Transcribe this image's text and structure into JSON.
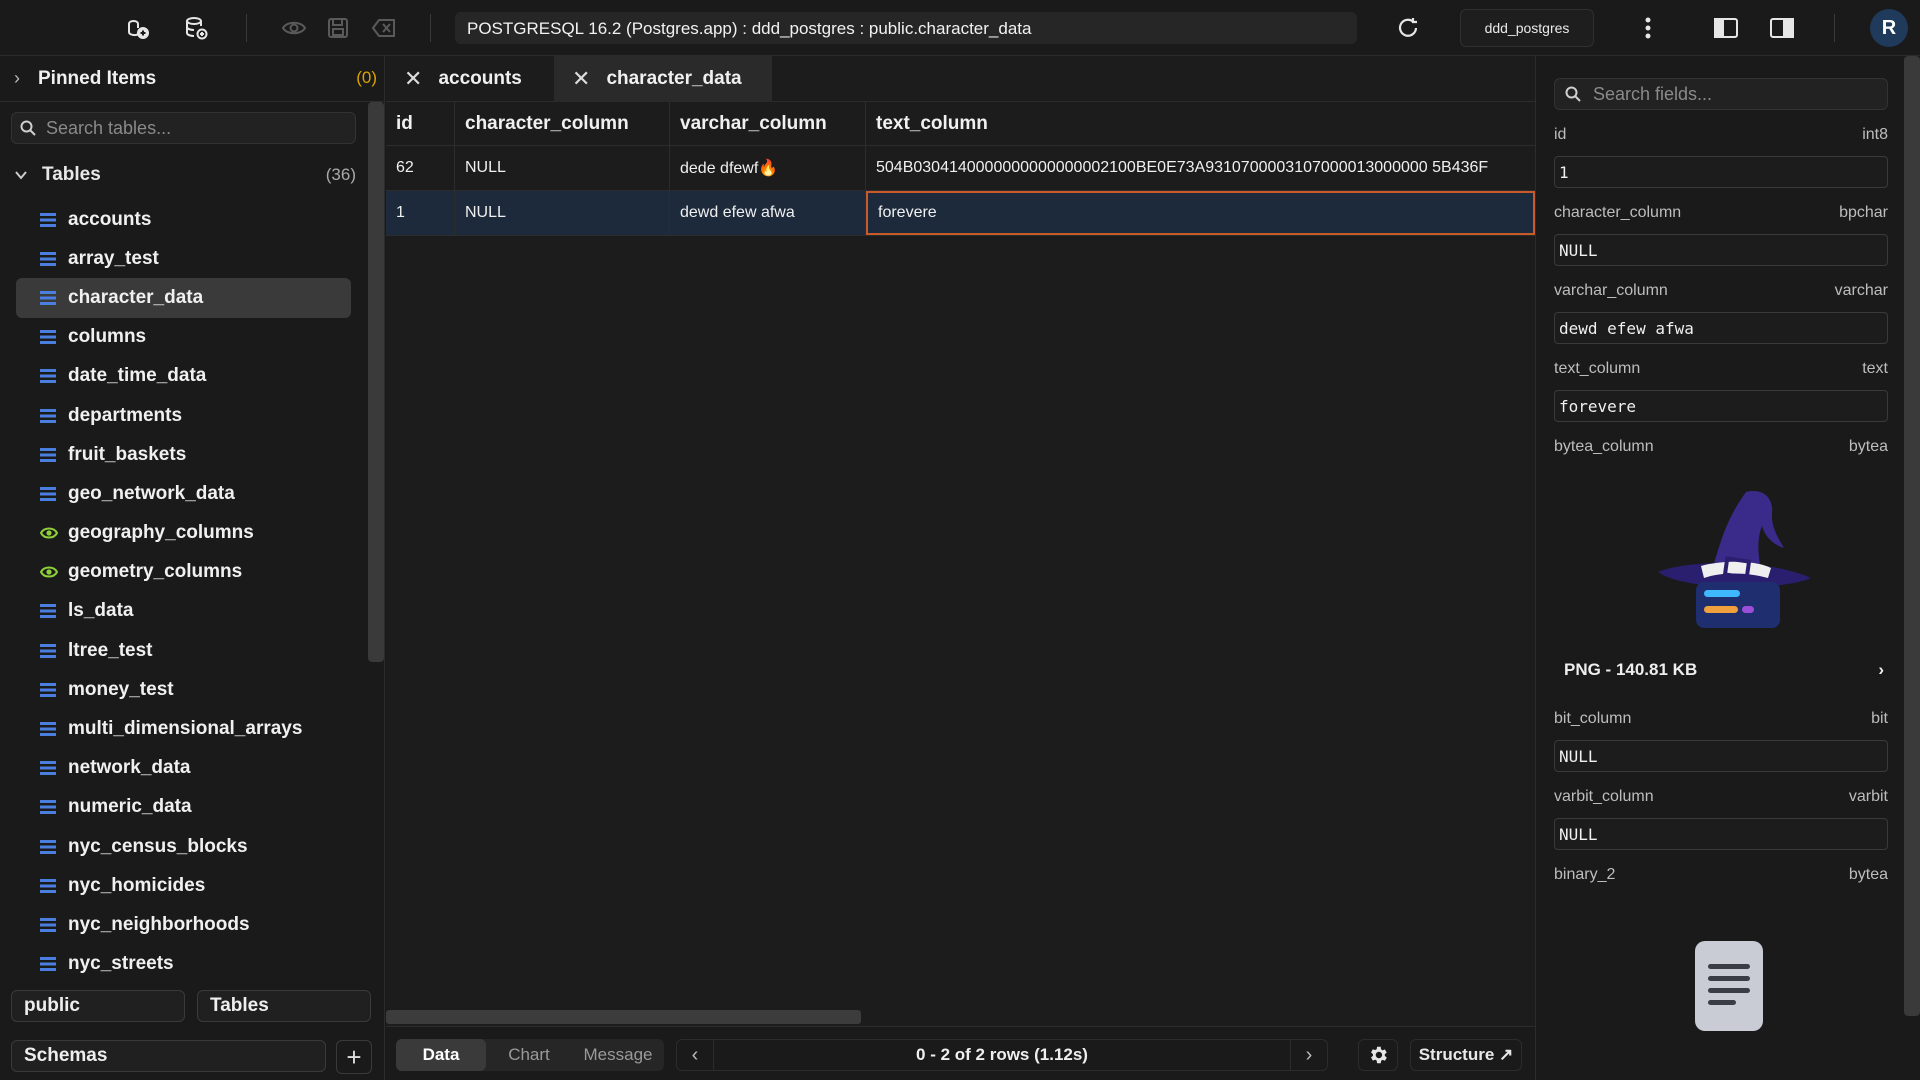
{
  "toolbar": {
    "connection": "POSTGRESQL 16.2 (Postgres.app) : ddd_postgres : public.character_data",
    "database_button": "ddd_postgres",
    "avatar_initial": "R"
  },
  "sidebar": {
    "pinned_title": "Pinned Items",
    "pinned_count": "(0)",
    "search_placeholder": "Search tables...",
    "tables_title": "Tables",
    "tables_count": "(36)",
    "tables": [
      {
        "name": "accounts",
        "icon": "table-icon"
      },
      {
        "name": "array_test",
        "icon": "table-icon"
      },
      {
        "name": "character_data",
        "icon": "table-icon",
        "selected": true
      },
      {
        "name": "columns",
        "icon": "table-icon"
      },
      {
        "name": "date_time_data",
        "icon": "table-icon"
      },
      {
        "name": "departments",
        "icon": "table-icon"
      },
      {
        "name": "fruit_baskets",
        "icon": "table-icon"
      },
      {
        "name": "geo_network_data",
        "icon": "table-icon"
      },
      {
        "name": "geography_columns",
        "icon": "view-icon"
      },
      {
        "name": "geometry_columns",
        "icon": "view-icon"
      },
      {
        "name": "ls_data",
        "icon": "table-icon"
      },
      {
        "name": "ltree_test",
        "icon": "table-icon"
      },
      {
        "name": "money_test",
        "icon": "table-icon"
      },
      {
        "name": "multi_dimensional_arrays",
        "icon": "table-icon"
      },
      {
        "name": "network_data",
        "icon": "table-icon"
      },
      {
        "name": "numeric_data",
        "icon": "table-icon"
      },
      {
        "name": "nyc_census_blocks",
        "icon": "table-icon"
      },
      {
        "name": "nyc_homicides",
        "icon": "table-icon"
      },
      {
        "name": "nyc_neighborhoods",
        "icon": "table-icon"
      },
      {
        "name": "nyc_streets",
        "icon": "table-icon"
      }
    ],
    "schema_button": "public",
    "type_button": "Tables",
    "schemas_button": "Schemas",
    "plus_label": "+"
  },
  "tabs": [
    {
      "label": "accounts",
      "active": false
    },
    {
      "label": "character_data",
      "active": true
    }
  ],
  "grid": {
    "columns": [
      "id",
      "character_column",
      "varchar_column",
      "text_column"
    ],
    "rows": [
      [
        "62",
        "NULL",
        "dede dfewf🔥",
        "504B0304140000000000000002100BE0E73A9310700003107000013000000 5B436F"
      ],
      [
        "1",
        "NULL",
        "dewd efew afwa",
        "forevere"
      ]
    ]
  },
  "bottom": {
    "view_tabs": [
      "Data",
      "Chart",
      "Message"
    ],
    "active_view": "Data",
    "pager_text": "0 - 2 of 2 rows   (1.12s)",
    "structure_button": "Structure ↗"
  },
  "detail": {
    "search_placeholder": "Search fields...",
    "fields": [
      {
        "name": "id",
        "type": "int8",
        "value": "1"
      },
      {
        "name": "character_column",
        "type": "bpchar",
        "value": "NULL"
      },
      {
        "name": "varchar_column",
        "type": "varchar",
        "value": "dewd efew afwa"
      },
      {
        "name": "text_column",
        "type": "text",
        "value": "forevere"
      }
    ],
    "bytea": {
      "name": "bytea_column",
      "type": "bytea",
      "image_info": "PNG - 140.81 KB"
    },
    "fields_after": [
      {
        "name": "bit_column",
        "type": "bit",
        "value": "NULL"
      },
      {
        "name": "varbit_column",
        "type": "varbit",
        "value": "NULL"
      }
    ],
    "binary2": {
      "name": "binary_2",
      "type": "bytea"
    }
  },
  "colors": {
    "accent_table_icon": "#4a7fe0",
    "accent_view_icon": "#8fcf3a",
    "pinned_count": "#d9a300",
    "focus_border": "#c95a2a",
    "selected_row": "#1d2a3c"
  }
}
